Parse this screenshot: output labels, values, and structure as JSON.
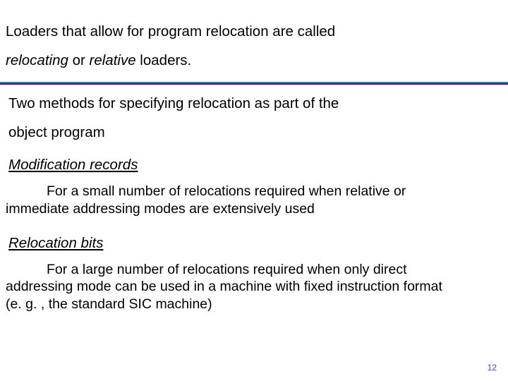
{
  "top": {
    "line1_a": "Loaders that allow for program relocation are called",
    "line2_i1": "relocating",
    "line2_mid": " or ",
    "line2_i2": "relative",
    "line2_tail": " loaders. "
  },
  "mid": {
    "line1": " Two methods for specifying relocation as part of the",
    "line2": "object program"
  },
  "method1": {
    "heading": " Modification records",
    "body_a": "For a small number of relocations required when relative or",
    "body_b": "immediate addressing modes are extensively used"
  },
  "method2": {
    "heading": " Relocation bits",
    "body_a": "For a large number of relocations required when only direct",
    "body_b": "addressing mode can be used in a machine with fixed instruction format",
    "body_c": "(e. g. , the standard SIC machine)"
  },
  "page_number": "12"
}
